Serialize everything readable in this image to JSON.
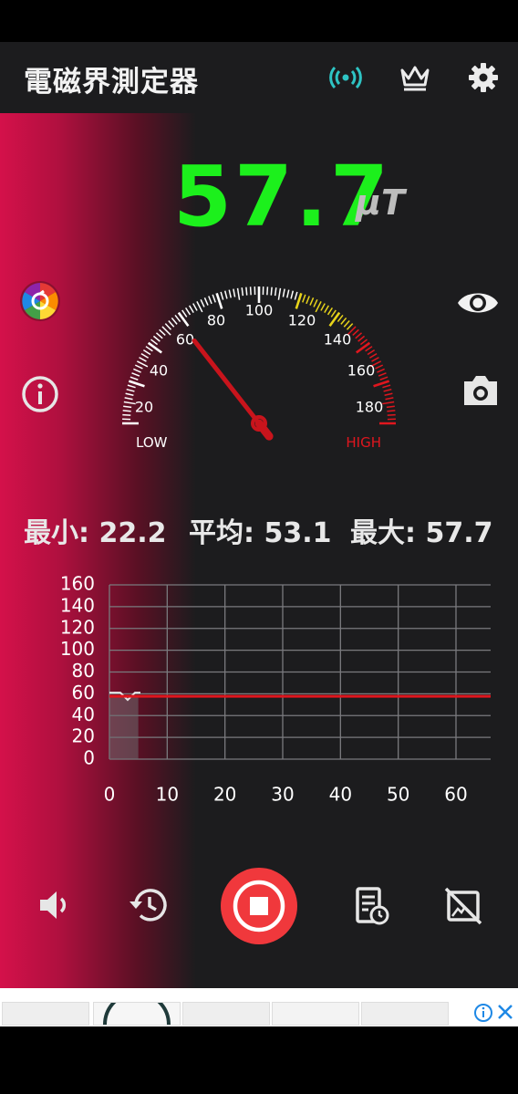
{
  "app": {
    "title": "電磁界測定器",
    "accent_color": "#1cf01c",
    "background_color": "#1c1c1e"
  },
  "toolbar": {
    "icons": [
      "broadcast-icon",
      "crown-icon",
      "gear-icon"
    ]
  },
  "reading": {
    "value": "57.7",
    "unit": "μT"
  },
  "side_icons": [
    "color-wheel-icon",
    "info-icon",
    "eye-icon",
    "camera-icon"
  ],
  "gauge": {
    "min": 0,
    "max": 200,
    "value": 57.7,
    "labels": [
      "20",
      "40",
      "60",
      "80",
      "100",
      "120",
      "140",
      "160",
      "180"
    ],
    "low_label": "LOW",
    "high_label": "HIGH",
    "zone_colors": {
      "normal": "#ffffff",
      "caution": "#e8d41a",
      "danger": "#e0161e"
    }
  },
  "stats": {
    "min_label": "最小:",
    "min_value": "22.2",
    "avg_label": "平均:",
    "avg_value": "53.1",
    "max_label": "最大:",
    "max_value": "57.7"
  },
  "graph": {
    "y_ticks": [
      "160",
      "140",
      "120",
      "100",
      "80",
      "60",
      "40",
      "20",
      "0"
    ],
    "x_ticks": [
      "0",
      "10",
      "20",
      "30",
      "40",
      "50",
      "60"
    ],
    "line_value": 57.7,
    "line_color": "#e0161e"
  },
  "controls": [
    "volume-icon",
    "history-icon",
    "stop-record-button",
    "report-icon",
    "screen-off-icon"
  ],
  "ad": {
    "badge_icon": "ad-info-icon",
    "close_icon": "close-icon"
  }
}
